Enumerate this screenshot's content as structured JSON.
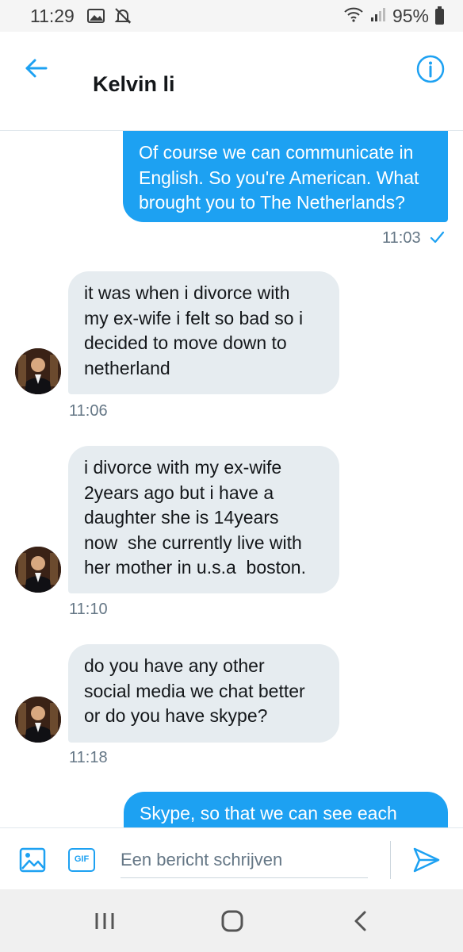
{
  "status_bar": {
    "time": "11:29",
    "battery": "95%",
    "icons": [
      "image-icon",
      "mute-icon",
      "wifi-icon",
      "signal-icon",
      "battery-icon"
    ]
  },
  "header": {
    "title": "Kelvin li",
    "icons": [
      "back-arrow-icon",
      "info-icon"
    ]
  },
  "messages": [
    {
      "direction": "outgoing",
      "lines": [
        "Of course we can communicate in",
        "English. So you're American. What",
        "brought you to The Netherlands?"
      ],
      "time": "11:03",
      "read_icon": "checkmark-icon"
    },
    {
      "direction": "incoming",
      "lines": [
        "it was when i divorce with",
        "my ex-wife i felt so bad so i",
        "decided to move down to",
        "netherland"
      ],
      "time": "11:06"
    },
    {
      "direction": "incoming",
      "lines": [
        "i divorce with my ex-wife",
        "2years ago but i have a",
        "daughter she is 14years",
        "now  she currently live with",
        "her mother in u.s.a  boston."
      ],
      "time": "11:10"
    },
    {
      "direction": "incoming",
      "lines": [
        "do you have any other",
        "social media we chat better",
        "or do you have skype?"
      ],
      "time": "11:18"
    },
    {
      "direction": "outgoing",
      "lines": [
        "Skype, so that we can see each"
      ]
    }
  ],
  "composer": {
    "placeholder": "Een bericht schrijven",
    "gif_label": "GIF",
    "icons": [
      "image-icon",
      "gif-icon",
      "send-icon"
    ]
  },
  "nav_bar": {
    "icons": [
      "recent-apps-icon",
      "home-icon",
      "back-icon"
    ]
  },
  "colors": {
    "accent": "#1da1f2",
    "incoming_bubble": "#e6ecf0",
    "text_secondary": "#657786"
  }
}
